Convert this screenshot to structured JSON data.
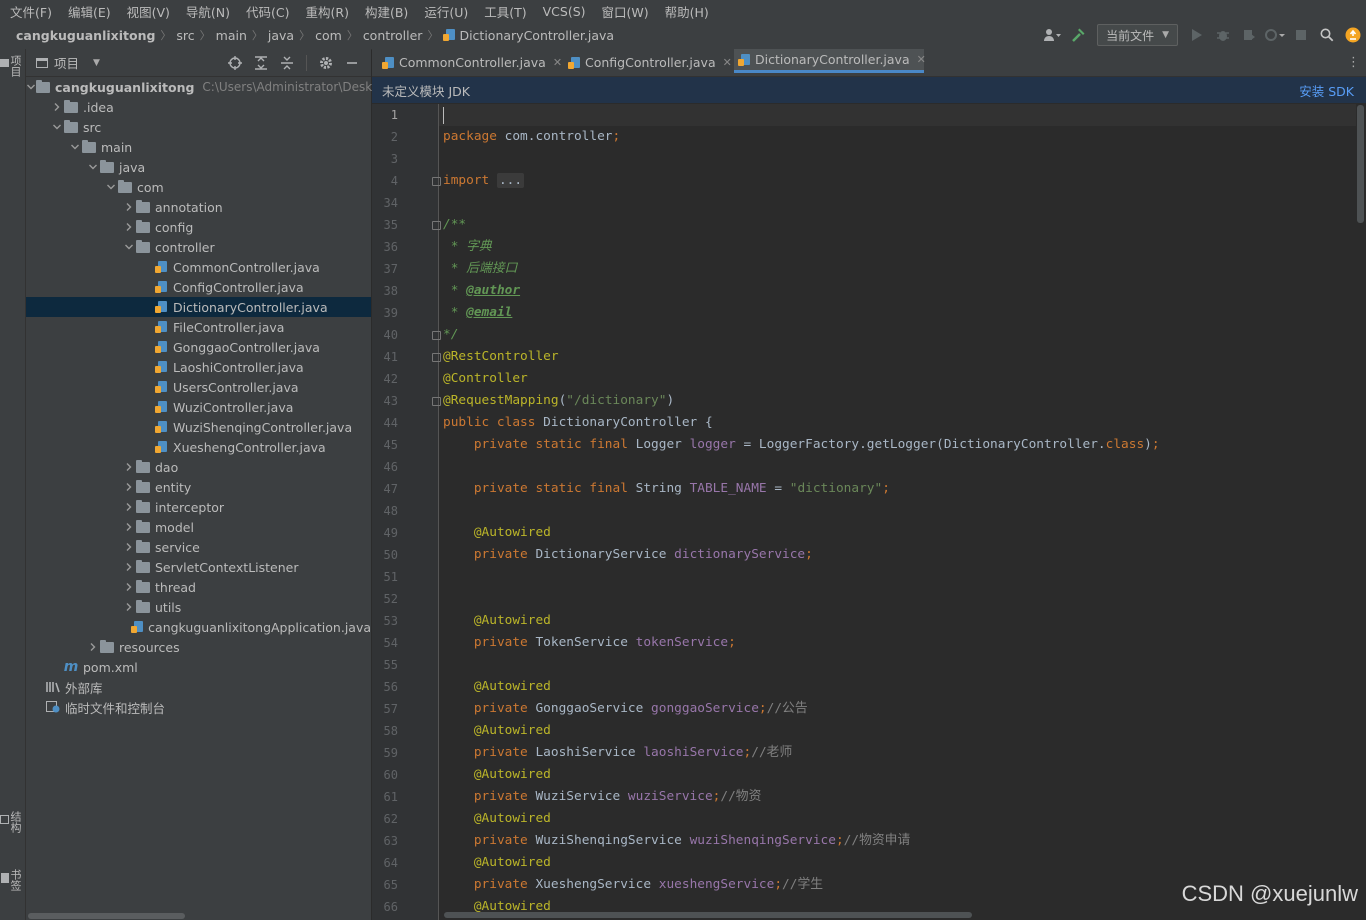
{
  "menu": [
    "文件(F)",
    "编辑(E)",
    "视图(V)",
    "导航(N)",
    "代码(C)",
    "重构(R)",
    "构建(B)",
    "运行(U)",
    "工具(T)",
    "VCS(S)",
    "窗口(W)",
    "帮助(H)"
  ],
  "breadcrumbs": [
    "cangkuguanlixitong",
    "src",
    "main",
    "java",
    "com",
    "controller",
    "DictionaryController.java"
  ],
  "run_config": "当前文件",
  "left_strip": {
    "project": "项目",
    "structure": "结构",
    "bookmarks": "书签"
  },
  "project_panel": {
    "title": "项目"
  },
  "tree": [
    {
      "label": "cangkuguanlixitong",
      "path": "C:\\Users\\Administrator\\Deskto",
      "level": 0,
      "type": "folder",
      "expanded": true,
      "bold": true
    },
    {
      "label": ".idea",
      "level": 1,
      "type": "folder",
      "expanded": false
    },
    {
      "label": "src",
      "level": 1,
      "type": "folder",
      "expanded": true
    },
    {
      "label": "main",
      "level": 2,
      "type": "folder",
      "expanded": true
    },
    {
      "label": "java",
      "level": 3,
      "type": "folder",
      "expanded": true
    },
    {
      "label": "com",
      "level": 4,
      "type": "folder",
      "expanded": true
    },
    {
      "label": "annotation",
      "level": 5,
      "type": "folder",
      "expanded": false
    },
    {
      "label": "config",
      "level": 5,
      "type": "folder",
      "expanded": false
    },
    {
      "label": "controller",
      "level": 5,
      "type": "folder",
      "expanded": true
    },
    {
      "label": "CommonController.java",
      "level": 6,
      "type": "java"
    },
    {
      "label": "ConfigController.java",
      "level": 6,
      "type": "java"
    },
    {
      "label": "DictionaryController.java",
      "level": 6,
      "type": "java",
      "selected": true
    },
    {
      "label": "FileController.java",
      "level": 6,
      "type": "java"
    },
    {
      "label": "GonggaoController.java",
      "level": 6,
      "type": "java"
    },
    {
      "label": "LaoshiController.java",
      "level": 6,
      "type": "java"
    },
    {
      "label": "UsersController.java",
      "level": 6,
      "type": "java"
    },
    {
      "label": "WuziController.java",
      "level": 6,
      "type": "java"
    },
    {
      "label": "WuziShenqingController.java",
      "level": 6,
      "type": "java"
    },
    {
      "label": "XueshengController.java",
      "level": 6,
      "type": "java"
    },
    {
      "label": "dao",
      "level": 5,
      "type": "folder",
      "expanded": false
    },
    {
      "label": "entity",
      "level": 5,
      "type": "folder",
      "expanded": false
    },
    {
      "label": "interceptor",
      "level": 5,
      "type": "folder",
      "expanded": false
    },
    {
      "label": "model",
      "level": 5,
      "type": "folder",
      "expanded": false
    },
    {
      "label": "service",
      "level": 5,
      "type": "folder",
      "expanded": false
    },
    {
      "label": "ServletContextListener",
      "level": 5,
      "type": "folder",
      "expanded": false
    },
    {
      "label": "thread",
      "level": 5,
      "type": "folder",
      "expanded": false
    },
    {
      "label": "utils",
      "level": 5,
      "type": "folder",
      "expanded": false
    },
    {
      "label": "cangkuguanlixitongApplication.java",
      "level": 5,
      "type": "java"
    },
    {
      "label": "resources",
      "level": 3,
      "type": "folder",
      "expanded": false
    },
    {
      "label": "pom.xml",
      "level": 1,
      "type": "maven"
    },
    {
      "label": "外部库",
      "level": 0,
      "type": "library"
    },
    {
      "label": "临时文件和控制台",
      "level": 0,
      "type": "scratch"
    }
  ],
  "tabs": [
    {
      "label": "CommonController.java",
      "active": false
    },
    {
      "label": "ConfigController.java",
      "active": false
    },
    {
      "label": "DictionaryController.java",
      "active": true
    }
  ],
  "banner": {
    "message": "未定义模块 JDK",
    "action": "安装 SDK"
  },
  "code_lines": [
    {
      "n": "1",
      "tokens": []
    },
    {
      "n": "2",
      "tokens": [
        [
          "kw",
          "package "
        ],
        [
          "",
          "com.controller"
        ],
        [
          "kw",
          ";"
        ]
      ]
    },
    {
      "n": "3",
      "tokens": []
    },
    {
      "n": "4",
      "tokens": [
        [
          "kw",
          "import "
        ],
        [
          "dots",
          "..."
        ]
      ]
    },
    {
      "n": "34",
      "tokens": []
    },
    {
      "n": "35",
      "tokens": [
        [
          "doc",
          "/**"
        ]
      ]
    },
    {
      "n": "36",
      "tokens": [
        [
          "doc",
          " * 字典"
        ]
      ]
    },
    {
      "n": "37",
      "tokens": [
        [
          "doc",
          " * 后端接口"
        ]
      ]
    },
    {
      "n": "38",
      "tokens": [
        [
          "doc",
          " * "
        ],
        [
          "doctag",
          "@author"
        ]
      ]
    },
    {
      "n": "39",
      "tokens": [
        [
          "doc",
          " * "
        ],
        [
          "doctag",
          "@email"
        ]
      ]
    },
    {
      "n": "40",
      "tokens": [
        [
          "doc",
          "*/"
        ]
      ]
    },
    {
      "n": "41",
      "tokens": [
        [
          "ann",
          "@RestController"
        ]
      ]
    },
    {
      "n": "42",
      "tokens": [
        [
          "ann",
          "@Controller"
        ]
      ]
    },
    {
      "n": "43",
      "tokens": [
        [
          "ann",
          "@RequestMapping"
        ],
        [
          "",
          "("
        ],
        [
          "str",
          "\"/dictionary\""
        ],
        [
          "",
          ")"
        ]
      ]
    },
    {
      "n": "44",
      "tokens": [
        [
          "kw",
          "public class "
        ],
        [
          "",
          "DictionaryController {"
        ]
      ]
    },
    {
      "n": "45",
      "tokens": [
        [
          "",
          "    "
        ],
        [
          "kw",
          "private static final "
        ],
        [
          "",
          "Logger "
        ],
        [
          "fld",
          "logger "
        ],
        [
          "",
          "= LoggerFactory."
        ],
        [
          "",
          "getLogger"
        ],
        [
          "",
          "(DictionaryController."
        ],
        [
          "kw",
          "class"
        ],
        [
          "",
          ")"
        ],
        [
          "kw",
          ";"
        ]
      ]
    },
    {
      "n": "46",
      "tokens": []
    },
    {
      "n": "47",
      "tokens": [
        [
          "",
          "    "
        ],
        [
          "kw",
          "private static final "
        ],
        [
          "",
          "String "
        ],
        [
          "fld",
          "TABLE_NAME "
        ],
        [
          "",
          "= "
        ],
        [
          "str",
          "\"dictionary\""
        ],
        [
          "kw",
          ";"
        ]
      ]
    },
    {
      "n": "48",
      "tokens": []
    },
    {
      "n": "49",
      "tokens": [
        [
          "",
          "    "
        ],
        [
          "ann",
          "@Autowired"
        ]
      ]
    },
    {
      "n": "50",
      "tokens": [
        [
          "",
          "    "
        ],
        [
          "kw",
          "private "
        ],
        [
          "",
          "DictionaryService "
        ],
        [
          "fld",
          "dictionaryService"
        ],
        [
          "kw",
          ";"
        ]
      ]
    },
    {
      "n": "51",
      "tokens": []
    },
    {
      "n": "52",
      "tokens": []
    },
    {
      "n": "53",
      "tokens": [
        [
          "",
          "    "
        ],
        [
          "ann",
          "@Autowired"
        ]
      ]
    },
    {
      "n": "54",
      "tokens": [
        [
          "",
          "    "
        ],
        [
          "kw",
          "private "
        ],
        [
          "",
          "TokenService "
        ],
        [
          "fld",
          "tokenService"
        ],
        [
          "kw",
          ";"
        ]
      ]
    },
    {
      "n": "55",
      "tokens": []
    },
    {
      "n": "56",
      "tokens": [
        [
          "",
          "    "
        ],
        [
          "ann",
          "@Autowired"
        ]
      ]
    },
    {
      "n": "57",
      "tokens": [
        [
          "",
          "    "
        ],
        [
          "kw",
          "private "
        ],
        [
          "",
          "GonggaoService "
        ],
        [
          "fld",
          "gonggaoService"
        ],
        [
          "kw",
          ";"
        ],
        [
          "cmt",
          "//公告"
        ]
      ]
    },
    {
      "n": "58",
      "tokens": [
        [
          "",
          "    "
        ],
        [
          "ann",
          "@Autowired"
        ]
      ]
    },
    {
      "n": "59",
      "tokens": [
        [
          "",
          "    "
        ],
        [
          "kw",
          "private "
        ],
        [
          "",
          "LaoshiService "
        ],
        [
          "fld",
          "laoshiService"
        ],
        [
          "kw",
          ";"
        ],
        [
          "cmt",
          "//老师"
        ]
      ]
    },
    {
      "n": "60",
      "tokens": [
        [
          "",
          "    "
        ],
        [
          "ann",
          "@Autowired"
        ]
      ]
    },
    {
      "n": "61",
      "tokens": [
        [
          "",
          "    "
        ],
        [
          "kw",
          "private "
        ],
        [
          "",
          "WuziService "
        ],
        [
          "fld",
          "wuziService"
        ],
        [
          "kw",
          ";"
        ],
        [
          "cmt",
          "//物资"
        ]
      ]
    },
    {
      "n": "62",
      "tokens": [
        [
          "",
          "    "
        ],
        [
          "ann",
          "@Autowired"
        ]
      ]
    },
    {
      "n": "63",
      "tokens": [
        [
          "",
          "    "
        ],
        [
          "kw",
          "private "
        ],
        [
          "",
          "WuziShenqingService "
        ],
        [
          "fld",
          "wuziShenqingService"
        ],
        [
          "kw",
          ";"
        ],
        [
          "cmt",
          "//物资申请"
        ]
      ]
    },
    {
      "n": "64",
      "tokens": [
        [
          "",
          "    "
        ],
        [
          "ann",
          "@Autowired"
        ]
      ]
    },
    {
      "n": "65",
      "tokens": [
        [
          "",
          "    "
        ],
        [
          "kw",
          "private "
        ],
        [
          "",
          "XueshengService "
        ],
        [
          "fld",
          "xueshengService"
        ],
        [
          "kw",
          ";"
        ],
        [
          "cmt",
          "//学生"
        ]
      ]
    },
    {
      "n": "66",
      "tokens": [
        [
          "",
          "    "
        ],
        [
          "ann",
          "@Autowired"
        ]
      ]
    }
  ],
  "watermark": "CSDN @xuejunlw",
  "colors": {
    "accent": "#4a88c7",
    "selection": "#0d293e",
    "banner_bg": "#223349",
    "link": "#589df6"
  }
}
